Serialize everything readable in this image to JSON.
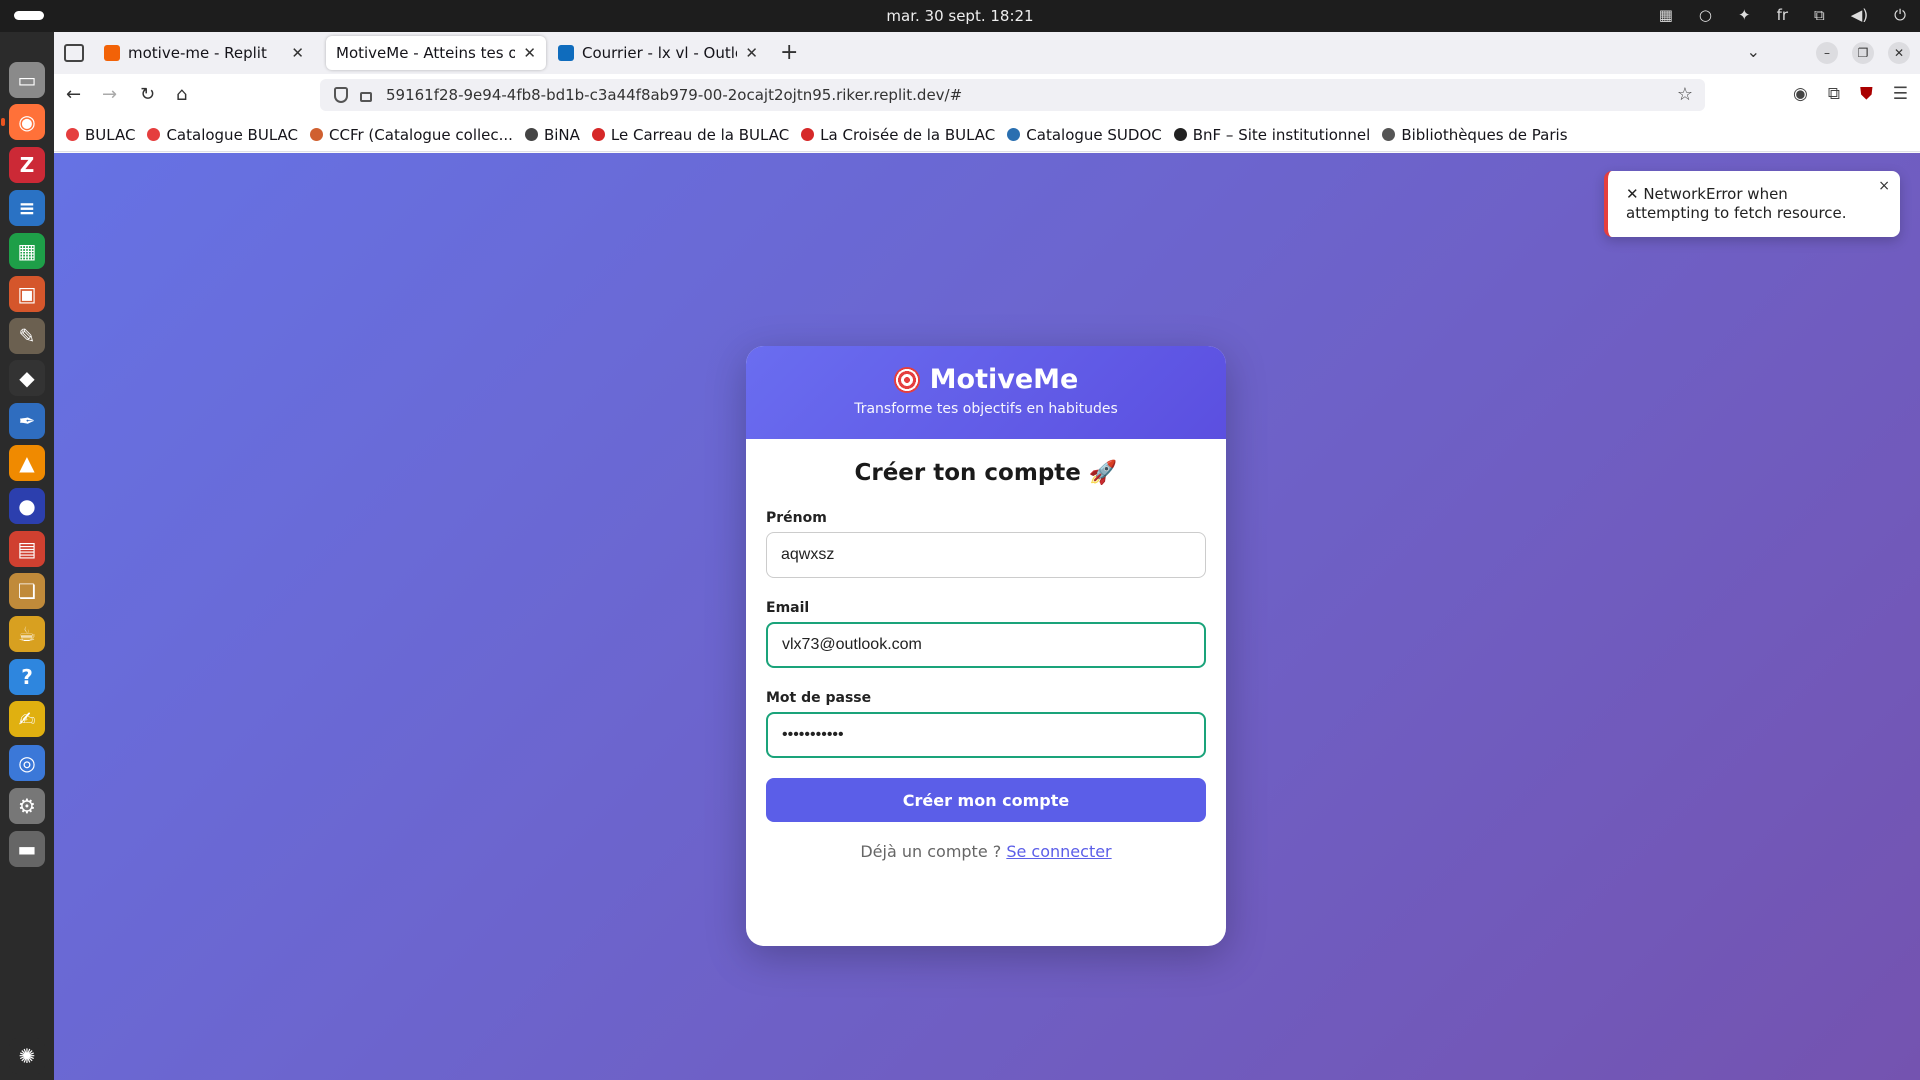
{
  "system": {
    "clock": "mar. 30 sept.  18:21",
    "language": "fr"
  },
  "dock": {
    "items": [
      {
        "name": "files",
        "color": "#8a8a8a",
        "glyph": "▭"
      },
      {
        "name": "firefox",
        "color": "#ff7139",
        "glyph": "◉"
      },
      {
        "name": "zotero",
        "color": "#cc2936",
        "glyph": "Z"
      },
      {
        "name": "writer",
        "color": "#2a72c4",
        "glyph": "≡"
      },
      {
        "name": "calc",
        "color": "#1e9f48",
        "glyph": "▦"
      },
      {
        "name": "impress",
        "color": "#d5562b",
        "glyph": "▣"
      },
      {
        "name": "gimp",
        "color": "#6b6050",
        "glyph": "✎"
      },
      {
        "name": "inkscape",
        "color": "#333333",
        "glyph": "◆"
      },
      {
        "name": "bluefish",
        "color": "#2f6dbf",
        "glyph": "✒"
      },
      {
        "name": "vlc",
        "color": "#f08a00",
        "glyph": "▲"
      },
      {
        "name": "app-blue",
        "color": "#2c3fae",
        "glyph": "●"
      },
      {
        "name": "document-viewer",
        "color": "#d04030",
        "glyph": "▤"
      },
      {
        "name": "ebook-reader",
        "color": "#c08a3a",
        "glyph": "❏"
      },
      {
        "name": "teapot",
        "color": "#d8a020",
        "glyph": "☕"
      },
      {
        "name": "help",
        "color": "#2e86de",
        "glyph": "?"
      },
      {
        "name": "text-editor",
        "color": "#e0b010",
        "glyph": "✍"
      },
      {
        "name": "chromium",
        "color": "#3b78d8",
        "glyph": "◎"
      },
      {
        "name": "settings",
        "color": "#777777",
        "glyph": "⚙"
      },
      {
        "name": "disk",
        "color": "#666666",
        "glyph": "▬"
      },
      {
        "name": "ubuntu",
        "color": "#2b2b2b",
        "glyph": "✺"
      }
    ]
  },
  "browser": {
    "tabs": [
      {
        "title": "motive-me - Replit",
        "favicon_color": "#f26207",
        "active": false
      },
      {
        "title": "MotiveMe - Atteins tes objec",
        "favicon_color": "#ffffff",
        "active": true
      },
      {
        "title": "Courrier - lx vl - Outlook",
        "favicon_color": "#0f6cbd",
        "active": false
      }
    ],
    "url": "59161f28-9e94-4fb8-bd1b-c3a44f8ab979-00-2ocajt2ojtn95.riker.replit.dev/#",
    "bookmarks": [
      {
        "label": "BULAC",
        "color": "#e53e3e"
      },
      {
        "label": "Catalogue BULAC",
        "color": "#e53e3e"
      },
      {
        "label": "CCFr (Catalogue collec...",
        "color": "#d06030"
      },
      {
        "label": "BiNA",
        "color": "#444444"
      },
      {
        "label": "Le Carreau de la BULAC",
        "color": "#d62828"
      },
      {
        "label": "La Croisée de la BULAC",
        "color": "#d62828"
      },
      {
        "label": "Catalogue SUDOC",
        "color": "#2a6fb0"
      },
      {
        "label": "BnF – Site institutionnel",
        "color": "#222222"
      },
      {
        "label": "Bibliothèques de Paris",
        "color": "#555555"
      }
    ]
  },
  "toast": {
    "message": "✕ NetworkError when attempting to fetch resource.",
    "close": "×"
  },
  "app": {
    "brand": "MotiveMe",
    "tagline": "Transforme tes objectifs en habitudes",
    "form_title": "Créer ton compte 🚀",
    "fields": {
      "firstname_label": "Prénom",
      "firstname_value": "aqwxsz",
      "email_label": "Email",
      "email_value": "vlx73@outlook.com",
      "password_label": "Mot de passe",
      "password_value": "•••••••••••"
    },
    "submit_label": "Créer mon compte",
    "login_prompt": "Déjà un compte ?",
    "login_link": "Se connecter"
  }
}
